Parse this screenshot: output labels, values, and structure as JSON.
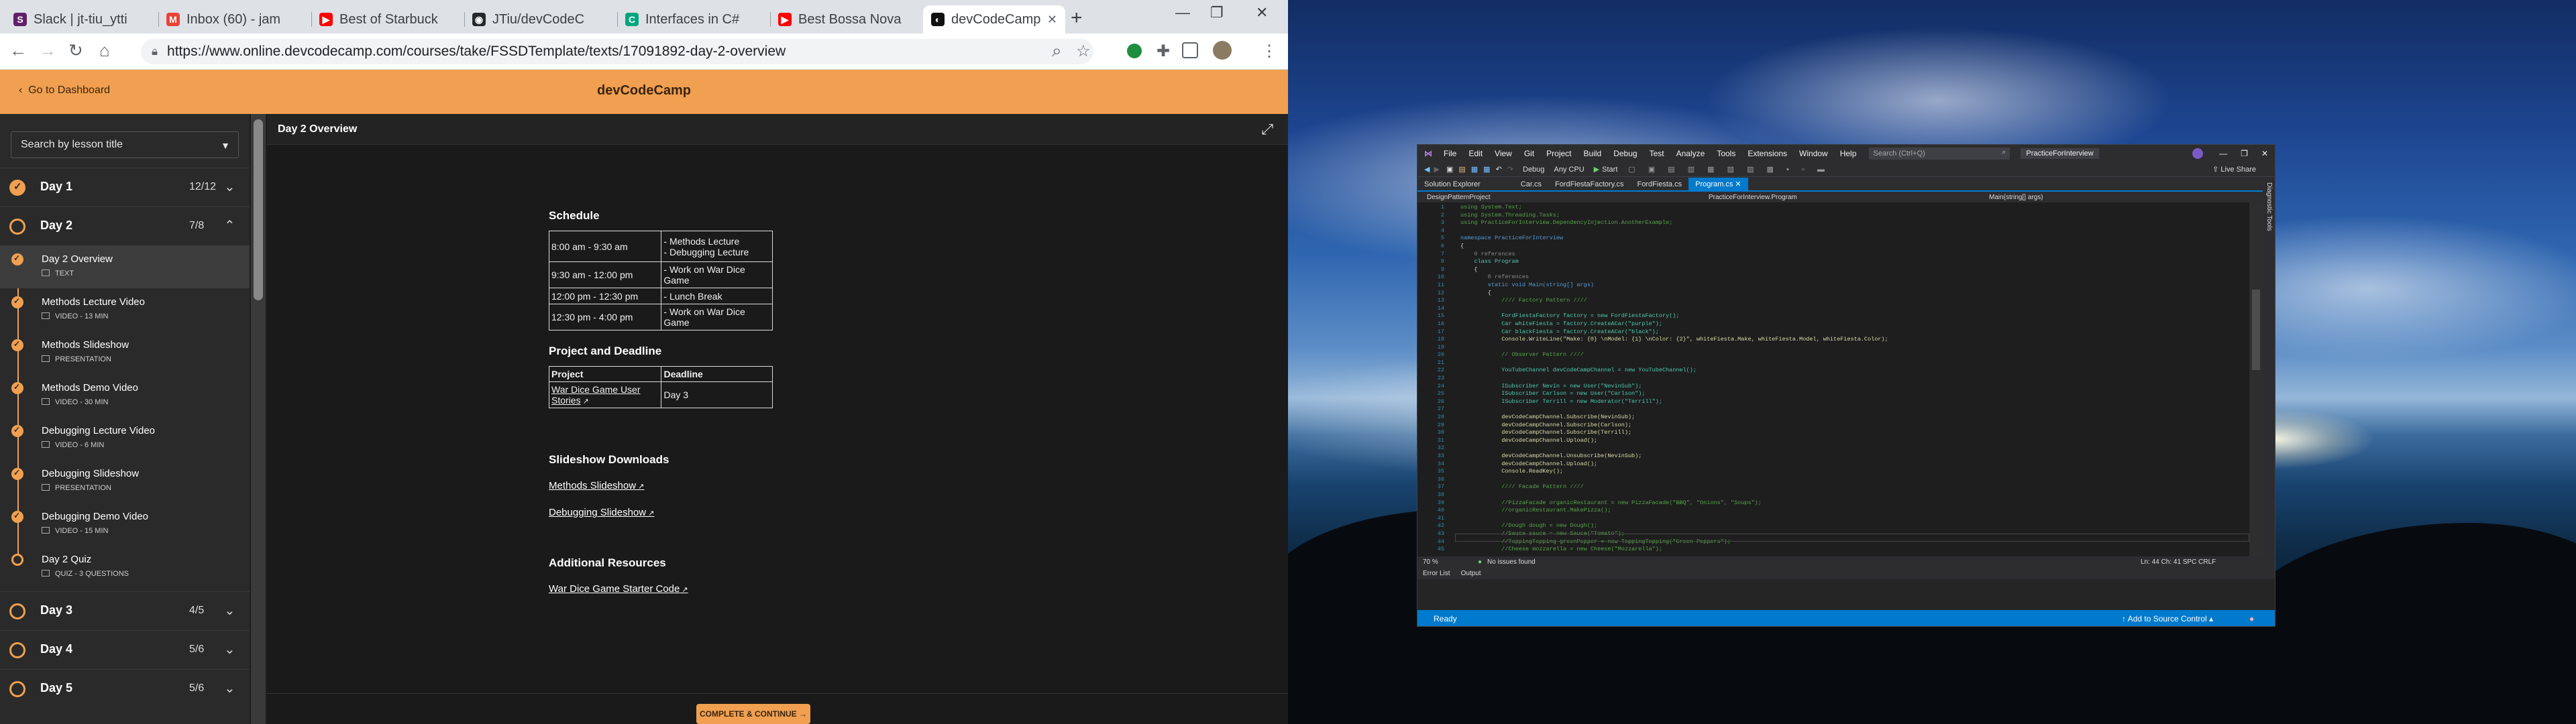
{
  "browser": {
    "tabs": [
      {
        "title": "Slack | jt-tiu_ytti",
        "icon_color": "#611f69",
        "glyph": "S"
      },
      {
        "title": "Inbox (60) - jam",
        "icon_color": "#ea4335",
        "glyph": "M"
      },
      {
        "title": "Best of Starbuck",
        "icon_color": "#ff0000",
        "glyph": "▶"
      },
      {
        "title": "JTiu/devCodeC",
        "icon_color": "#24292e",
        "glyph": "◉"
      },
      {
        "title": "Interfaces in C#",
        "icon_color": "#00a67e",
        "glyph": "C"
      },
      {
        "title": "Best Bossa Nova",
        "icon_color": "#ff0000",
        "glyph": "▶"
      },
      {
        "title": "devCodeCamp",
        "icon_color": "#111111",
        "glyph": "◐"
      }
    ],
    "new_tab": "+",
    "window_controls": {
      "min": "—",
      "max": "❐",
      "close": "✕"
    },
    "url": "https://www.online.devcodecamp.com/courses/take/FSSDTemplate/texts/17091892-day-2-overview",
    "nav": {
      "back": "←",
      "forward": "→",
      "reload": "↻",
      "home": "⌂"
    },
    "toolbar_icons": {
      "search": "⌕",
      "star": "☆",
      "extension": "✚",
      "menu": "⋮"
    }
  },
  "site": {
    "go_dashboard": "Go to Dashboard",
    "brand": "devCodeCamp",
    "search_placeholder": "Search by lesson title",
    "content_title": "Day 2 Overview",
    "complete_button": "COMPLETE & CONTINUE →"
  },
  "days": [
    {
      "name": "Day 1",
      "count": "12/12",
      "chevron": "⌄",
      "complete": true
    },
    {
      "name": "Day 2",
      "count": "7/8",
      "chevron": "⌃",
      "complete": false
    },
    {
      "name": "Day 3",
      "count": "4/5",
      "chevron": "⌄",
      "complete": false
    },
    {
      "name": "Day 4",
      "count": "5/6",
      "chevron": "⌄",
      "complete": false
    },
    {
      "name": "Day 5",
      "count": "5/6",
      "chevron": "⌄",
      "complete": false
    }
  ],
  "lessons": [
    {
      "name": "Day 2 Overview",
      "sub": "TEXT",
      "done": true,
      "selected": true
    },
    {
      "name": "Methods Lecture Video",
      "sub": "VIDEO - 13 MIN",
      "done": true
    },
    {
      "name": "Methods Slideshow",
      "sub": "PRESENTATION",
      "done": true
    },
    {
      "name": "Methods Demo Video",
      "sub": "VIDEO - 30 MIN",
      "done": true
    },
    {
      "name": "Debugging Lecture Video",
      "sub": "VIDEO - 6 MIN",
      "done": true
    },
    {
      "name": "Debugging Slideshow",
      "sub": "PRESENTATION",
      "done": true
    },
    {
      "name": "Debugging Demo Video",
      "sub": "VIDEO - 15 MIN",
      "done": true
    },
    {
      "name": "Day 2 Quiz",
      "sub": "QUIZ - 3 QUESTIONS",
      "done": false
    }
  ],
  "article": {
    "schedule_heading": "Schedule",
    "schedule": [
      {
        "time": "8:00 am - 9:30 am",
        "activity": [
          "- Methods Lecture",
          "- Debugging Lecture"
        ]
      },
      {
        "time": "9:30 am - 12:00 pm",
        "activity": [
          "- Work on War Dice Game"
        ]
      },
      {
        "time": "12:00 pm - 12:30 pm",
        "activity": [
          "- Lunch Break"
        ]
      },
      {
        "time": "12:30 pm - 4:00 pm",
        "activity": [
          "- Work on War Dice Game"
        ]
      }
    ],
    "project_heading": "Project and Deadline",
    "project_cols": [
      "Project",
      "Deadline"
    ],
    "project_row": {
      "project": "War Dice Game User Stories",
      "deadline": "Day 3"
    },
    "slides_heading": "Slideshow Downloads",
    "slides": [
      "Methods Slideshow",
      "Debugging Slideshow"
    ],
    "resources_heading": "Additional Resources",
    "resources": [
      "War Dice Game Starter Code"
    ]
  },
  "vs": {
    "menu": [
      "File",
      "Edit",
      "View",
      "Git",
      "Project",
      "Build",
      "Debug",
      "Test",
      "Analyze",
      "Tools",
      "Extensions",
      "Window",
      "Help"
    ],
    "search": "Search (Ctrl+Q)",
    "solution": "PracticeForInterview",
    "config": "Debug",
    "platform": "Any CPU",
    "start": "Start",
    "live_share": "Live Share",
    "tabs": [
      "Solution Explorer",
      "Car.cs",
      "FordFiestaFactory.cs",
      "FordFiesta.cs",
      "Program.cs"
    ],
    "nav_project": "DesignPatternProject",
    "nav_class": "PracticeForInterview.Program",
    "nav_member": "Main(string[] args)",
    "diag_tools": "Diagnostic Tools",
    "zoom": "70 %",
    "issues": "No issues found",
    "position": "Ln: 44   Ch: 41   SPC   CRLF",
    "bottom_tabs": [
      "Error List",
      "Output"
    ],
    "status_ready": "Ready",
    "source_control": "↑ Add to Source Control ▴",
    "code": [
      {
        "n": "1",
        "t": "using System.Text;",
        "c": "#57a64a"
      },
      {
        "n": "2",
        "t": "using System.Threading.Tasks;",
        "c": "#57a64a"
      },
      {
        "n": "3",
        "t": "using PracticeForInterview.DependencyInjection.AnotherExample;",
        "c": "#57a64a"
      },
      {
        "n": "4",
        "t": "",
        "c": "#ddd"
      },
      {
        "n": "5",
        "t": "namespace PracticeForInterview",
        "c": "#569cd6"
      },
      {
        "n": "6",
        "t": "{",
        "c": "#ddd"
      },
      {
        "n": "7",
        "t": "    0 references",
        "c": "#888"
      },
      {
        "n": "8",
        "t": "    class Program",
        "c": "#4ec9b0"
      },
      {
        "n": "9",
        "t": "    {",
        "c": "#ddd"
      },
      {
        "n": "10",
        "t": "        0 references",
        "c": "#888"
      },
      {
        "n": "11",
        "t": "        static void Main(string[] args)",
        "c": "#569cd6"
      },
      {
        "n": "12",
        "t": "        {",
        "c": "#ddd"
      },
      {
        "n": "13",
        "t": "            //// Factory Pattern ////",
        "c": "#57a64a"
      },
      {
        "n": "14",
        "t": "",
        "c": "#ddd"
      },
      {
        "n": "15",
        "t": "            FordFiestaFactory factory = new FordFiestaFactory();",
        "c": "#4ec9b0"
      },
      {
        "n": "16",
        "t": "            Car whiteFiesta = factory.CreateACar(\"purple\");",
        "c": "#4ec9b0"
      },
      {
        "n": "17",
        "t": "            Car blackFiesta = factory.CreateACar(\"black\");",
        "c": "#4ec9b0"
      },
      {
        "n": "18",
        "t": "            Console.WriteLine(\"Make: {0} \\nModel: {1} \\nColor: {2}\", whiteFiesta.Make, whiteFiesta.Model, whiteFiesta.Color);",
        "c": "#dcdcaa"
      },
      {
        "n": "19",
        "t": "",
        "c": "#ddd"
      },
      {
        "n": "20",
        "t": "            // Observer Pattern ////",
        "c": "#57a64a"
      },
      {
        "n": "21",
        "t": "",
        "c": "#ddd"
      },
      {
        "n": "22",
        "t": "            YouTubeChannel devCodeCampChannel = new YouTubeChannel();",
        "c": "#4ec9b0"
      },
      {
        "n": "23",
        "t": "",
        "c": "#ddd"
      },
      {
        "n": "24",
        "t": "            ISubscriber Nevin = new User(\"NevinSub\");",
        "c": "#4ec9b0"
      },
      {
        "n": "25",
        "t": "            ISubscriber Carlson = new User(\"Carlson\");",
        "c": "#4ec9b0"
      },
      {
        "n": "26",
        "t": "            ISubscriber Terrill = new Moderator(\"Terrill\");",
        "c": "#4ec9b0"
      },
      {
        "n": "27",
        "t": "",
        "c": "#ddd"
      },
      {
        "n": "28",
        "t": "            devCodeCampChannel.Subscribe(NevinSub);",
        "c": "#dcdcaa"
      },
      {
        "n": "29",
        "t": "            devCodeCampChannel.Subscribe(Carlson);",
        "c": "#dcdcaa"
      },
      {
        "n": "30",
        "t": "            devCodeCampChannel.Subscribe(Terrill);",
        "c": "#dcdcaa"
      },
      {
        "n": "31",
        "t": "            devCodeCampChannel.Upload();",
        "c": "#dcdcaa"
      },
      {
        "n": "32",
        "t": "",
        "c": "#ddd"
      },
      {
        "n": "33",
        "t": "            devCodeCampChannel.Unsubscribe(NevinSub);",
        "c": "#dcdcaa"
      },
      {
        "n": "34",
        "t": "            devCodeCampChannel.Upload();",
        "c": "#dcdcaa"
      },
      {
        "n": "35",
        "t": "            Console.ReadKey();",
        "c": "#dcdcaa"
      },
      {
        "n": "36",
        "t": "",
        "c": "#ddd"
      },
      {
        "n": "37",
        "t": "            //// Facade Pattern ////",
        "c": "#57a64a"
      },
      {
        "n": "38",
        "t": "",
        "c": "#ddd"
      },
      {
        "n": "39",
        "t": "            //PizzaFacade organicRestaurant = new PizzaFacade(\"BBQ\", \"Onions\", \"Soups\");",
        "c": "#57a64a"
      },
      {
        "n": "40",
        "t": "            //organicRestaurant.MakePizza();",
        "c": "#57a64a"
      },
      {
        "n": "41",
        "t": "",
        "c": "#ddd"
      },
      {
        "n": "42",
        "t": "            //Dough dough = new Dough();",
        "c": "#57a64a"
      },
      {
        "n": "43",
        "t": "            //Sauce sauce = new Sauce(\"Tomato\");",
        "c": "#57a64a"
      },
      {
        "n": "44",
        "t": "            //ToppingTopping greenPepper = new ToppingTopping(\"Green Peppers\");",
        "c": "#57a64a"
      },
      {
        "n": "45",
        "t": "            //Cheese mozzarella = new Cheese(\"Mozzarella\");",
        "c": "#57a64a"
      }
    ]
  }
}
